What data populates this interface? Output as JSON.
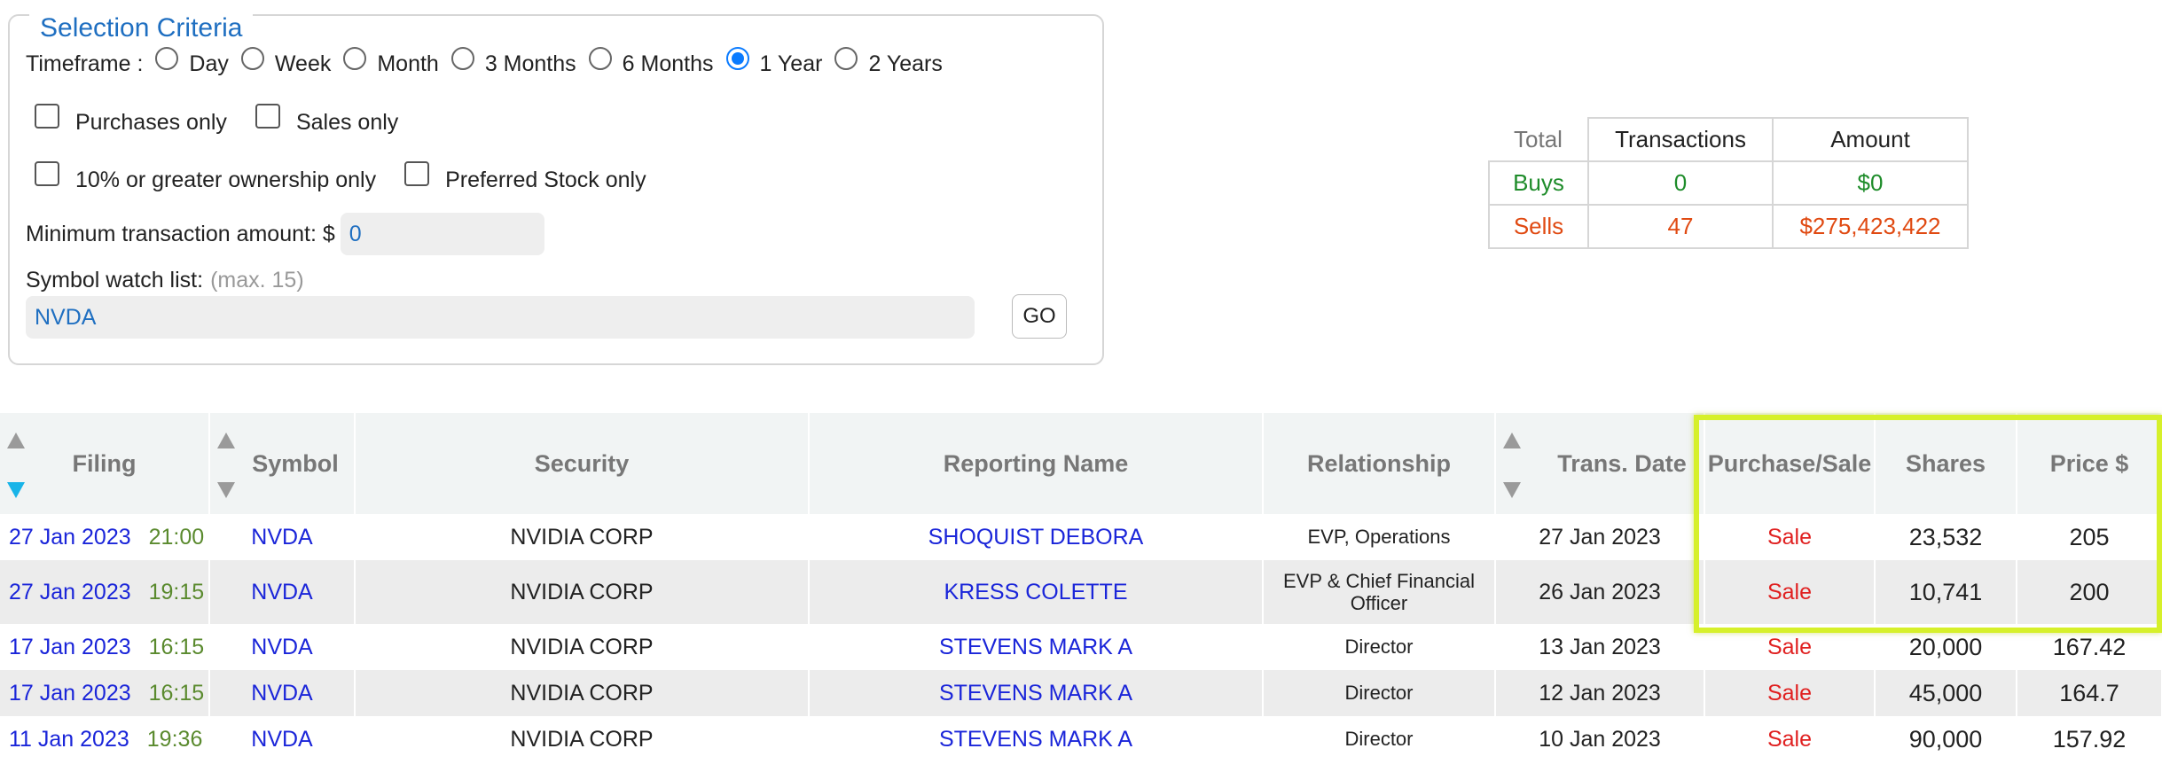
{
  "criteria": {
    "title": "Selection Criteria",
    "timeframe_label": "Timeframe :",
    "timeframes": [
      "Day",
      "Week",
      "Month",
      "3 Months",
      "6 Months",
      "1 Year",
      "2 Years"
    ],
    "selected_timeframe": "1 Year",
    "purchases_only": "Purchases only",
    "sales_only": "Sales only",
    "ownership_only": "10% or greater ownership only",
    "preferred_only": "Preferred Stock only",
    "min_amount_label": "Minimum transaction amount: $",
    "min_amount_value": "0",
    "watchlist_label": "Symbol watch list:",
    "watchlist_hint": "(max. 15)",
    "watchlist_value": "NVDA",
    "go_label": "GO"
  },
  "summary": {
    "total_label": "Total",
    "transactions_header": "Transactions",
    "amount_header": "Amount",
    "buys_label": "Buys",
    "buys_count": "0",
    "buys_amount": "$0",
    "sells_label": "Sells",
    "sells_count": "47",
    "sells_amount": "$275,423,422",
    "colors": {
      "buy": "#1e8c2a",
      "sell": "#e04a12"
    }
  },
  "table": {
    "headers": {
      "filing": "Filing",
      "symbol": "Symbol",
      "security": "Security",
      "reporting_name": "Reporting Name",
      "relationship": "Relationship",
      "trans_date": "Trans. Date",
      "purchase_sale": "Purchase/Sale",
      "shares": "Shares",
      "price": "Price $"
    },
    "rows": [
      {
        "filing_date": "27 Jan 2023",
        "filing_time": "21:00",
        "symbol": "NVDA",
        "security": "NVIDIA CORP",
        "name": "SHOQUIST DEBORA",
        "relationship": "EVP, Operations",
        "trans_date": "27 Jan 2023",
        "type": "Sale",
        "shares": "23,532",
        "price": "205"
      },
      {
        "filing_date": "27 Jan 2023",
        "filing_time": "19:15",
        "symbol": "NVDA",
        "security": "NVIDIA CORP",
        "name": "KRESS COLETTE",
        "relationship": "EVP & Chief Financial Officer",
        "trans_date": "26 Jan 2023",
        "type": "Sale",
        "shares": "10,741",
        "price": "200"
      },
      {
        "filing_date": "17 Jan 2023",
        "filing_time": "16:15",
        "symbol": "NVDA",
        "security": "NVIDIA CORP",
        "name": "STEVENS MARK A",
        "relationship": "Director",
        "trans_date": "13 Jan 2023",
        "type": "Sale",
        "shares": "20,000",
        "price": "167.42"
      },
      {
        "filing_date": "17 Jan 2023",
        "filing_time": "16:15",
        "symbol": "NVDA",
        "security": "NVIDIA CORP",
        "name": "STEVENS MARK A",
        "relationship": "Director",
        "trans_date": "12 Jan 2023",
        "type": "Sale",
        "shares": "45,000",
        "price": "164.7"
      },
      {
        "filing_date": "11 Jan 2023",
        "filing_time": "19:36",
        "symbol": "NVDA",
        "security": "NVIDIA CORP",
        "name": "STEVENS MARK A",
        "relationship": "Director",
        "trans_date": "10 Jan 2023",
        "type": "Sale",
        "shares": "90,000",
        "price": "157.92"
      }
    ]
  }
}
